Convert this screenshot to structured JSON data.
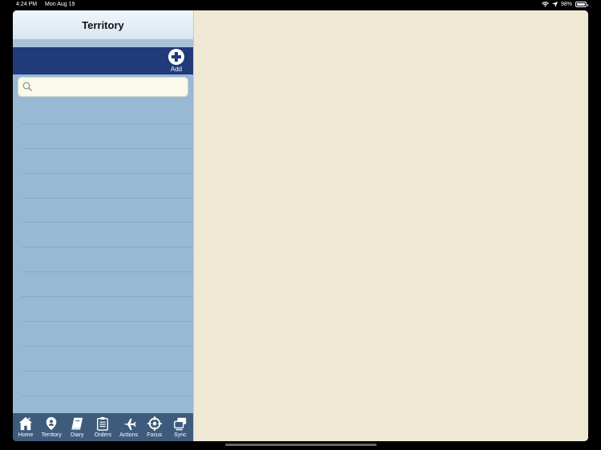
{
  "status": {
    "time": "4:24 PM",
    "date": "Mon Aug 19",
    "battery": "98%",
    "battery_level": 0.98
  },
  "nav": {
    "title": "Territory"
  },
  "toolbar": {
    "add_label": "Add"
  },
  "search": {
    "value": "",
    "placeholder": ""
  },
  "list": {
    "row_count": 13
  },
  "tabs": [
    {
      "label": "Home",
      "icon": "home-icon"
    },
    {
      "label": "Territory",
      "icon": "map-pin-icon"
    },
    {
      "label": "Diary",
      "icon": "book-icon"
    },
    {
      "label": "Orders",
      "icon": "clipboard-icon"
    },
    {
      "label": "Actions",
      "icon": "plane-icon"
    },
    {
      "label": "Focus",
      "icon": "target-icon"
    },
    {
      "label": "Sync",
      "icon": "sync-icon"
    }
  ],
  "colors": {
    "nav_bar": "#213a79",
    "sidebar": "#98b9d3",
    "detail": "#efe8d5",
    "tab_bar": "#3f5b7c"
  }
}
